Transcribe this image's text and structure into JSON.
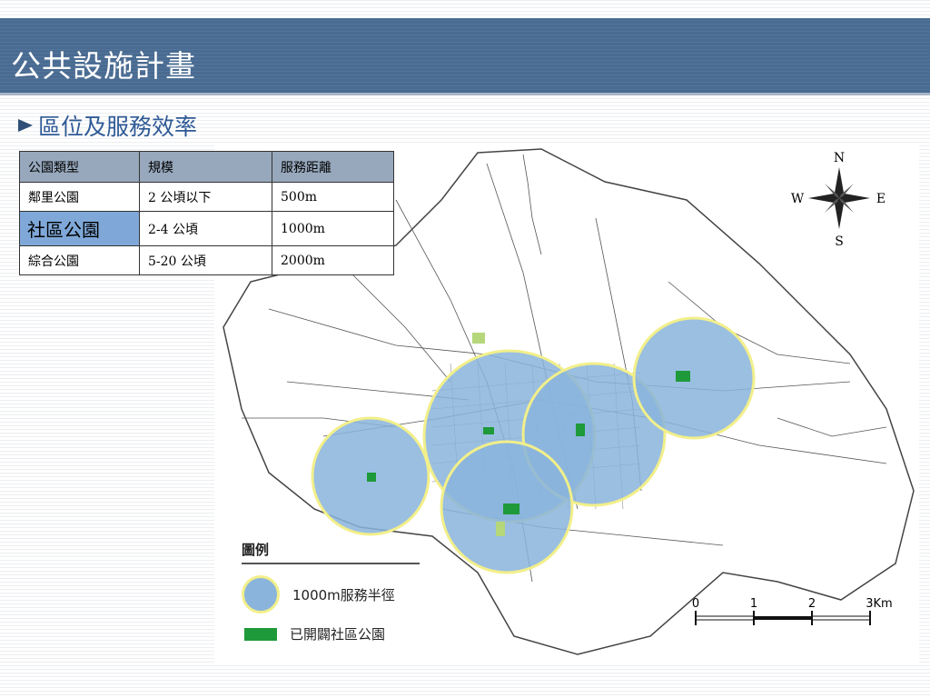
{
  "slide": {
    "title": "公共設施計畫",
    "subtitle": "區位及服務效率"
  },
  "table": {
    "headers": [
      "公園類型",
      "規模",
      "服務距離"
    ],
    "rows": [
      {
        "type": "鄰里公園",
        "scale": "2 公頃以下",
        "distance": "500m",
        "highlight": false
      },
      {
        "type": "社區公園",
        "scale": "2-4 公頃",
        "distance": "1000m",
        "highlight": true
      },
      {
        "type": "綜合公園",
        "scale": "5-20 公頃",
        "distance": "2000m",
        "highlight": false
      }
    ]
  },
  "map": {
    "compass": {
      "n": "N",
      "s": "S",
      "e": "E",
      "w": "W"
    },
    "legend": {
      "title": "圖例",
      "service_radius": "1000m服務半徑",
      "opened_parks": "已開闢社區公園"
    },
    "scale_bar": {
      "labels": [
        "0",
        "1",
        "2",
        "3Km"
      ]
    },
    "colors": {
      "service_area": "#8ab4dc",
      "park": "#1e9a3a",
      "border": "#f2ef8a"
    }
  }
}
